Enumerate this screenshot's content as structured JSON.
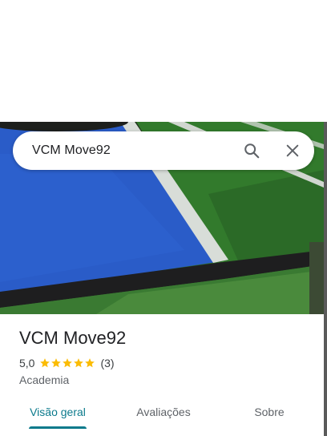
{
  "search": {
    "query": "VCM Move92"
  },
  "place": {
    "title": "VCM Move92",
    "rating": "5,0",
    "stars": 5,
    "review_count": "(3)",
    "category": "Academia"
  },
  "tabs": [
    {
      "label": "Visão geral",
      "selected": true
    },
    {
      "label": "Avaliações",
      "selected": false
    },
    {
      "label": "Sobre",
      "selected": false
    }
  ],
  "colors": {
    "accent": "#0b7a8c",
    "star": "#fbbc04",
    "turf_blue": "#2a5cc8",
    "turf_green": "#2e6a2a"
  },
  "icons": {
    "search": "search-icon",
    "close": "close-icon",
    "star": "star-icon"
  }
}
